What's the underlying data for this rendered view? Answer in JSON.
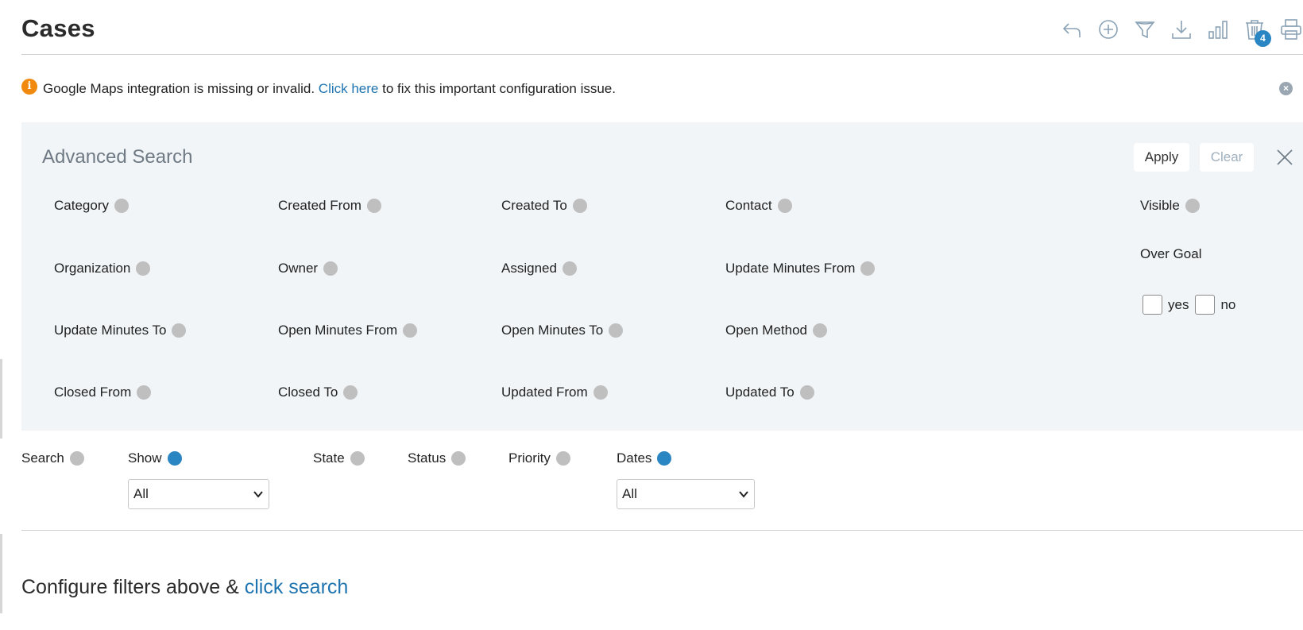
{
  "page": {
    "title": "Cases"
  },
  "toolbar": {
    "icons": [
      "back-arrow-icon",
      "add-circle-icon",
      "filter-icon",
      "download-icon",
      "bar-chart-icon",
      "trash-icon",
      "print-icon"
    ],
    "trash_badge": "4"
  },
  "alert": {
    "icon": "info-icon",
    "text_before": "Google Maps integration is missing or invalid.",
    "link": "Click here",
    "text_after": "to fix this important configuration issue."
  },
  "advanced_search": {
    "title": "Advanced Search",
    "apply_label": "Apply",
    "clear_label": "Clear",
    "fields": {
      "category": "Category",
      "created_from": "Created From",
      "created_to": "Created To",
      "contact": "Contact",
      "visible": "Visible",
      "organization": "Organization",
      "owner": "Owner",
      "assigned": "Assigned",
      "update_minutes_from": "Update Minutes From",
      "over_goal": "Over Goal",
      "update_minutes_to": "Update Minutes To",
      "open_minutes_from": "Open Minutes From",
      "open_minutes_to": "Open Minutes To",
      "open_method": "Open Method",
      "closed_from": "Closed From",
      "closed_to": "Closed To",
      "updated_from": "Updated From",
      "updated_to": "Updated To"
    },
    "over_goal_options": {
      "yes": "yes",
      "no": "no"
    }
  },
  "filters": {
    "search": "Search",
    "show": "Show",
    "show_value": "All",
    "state": "State",
    "status": "Status",
    "priority": "Priority",
    "dates": "Dates",
    "dates_value": "All",
    "active_color": "#2a86c3",
    "inactive_color": "#bfbfbf"
  },
  "footer": {
    "configure_text": "Configure filters above &",
    "configure_link": "click search"
  }
}
